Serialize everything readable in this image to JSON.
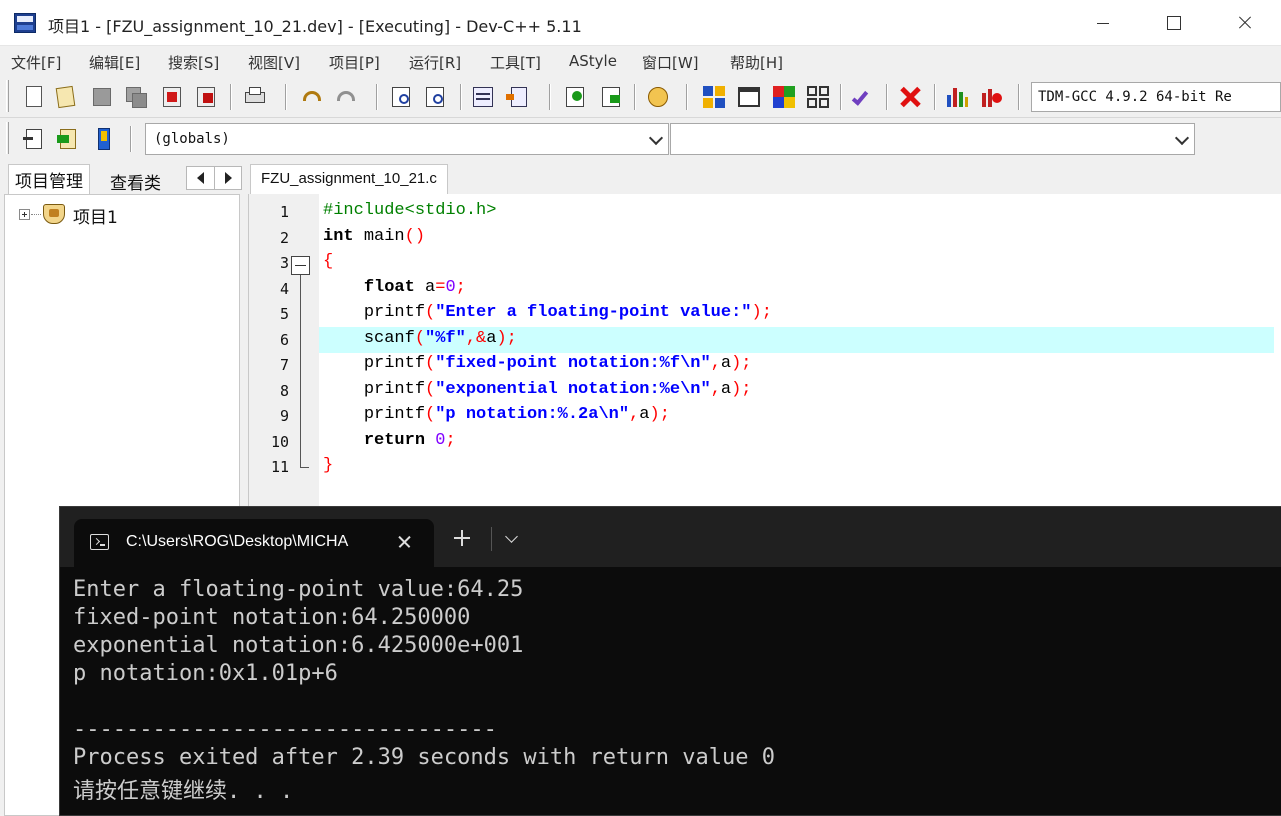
{
  "window": {
    "title": "项目1 - [FZU_assignment_10_21.dev] - [Executing] - Dev-C++ 5.11"
  },
  "menu": [
    "文件[F]",
    "编辑[E]",
    "搜索[S]",
    "视图[V]",
    "项目[P]",
    "运行[R]",
    "工具[T]",
    "AStyle",
    "窗口[W]",
    "帮助[H]"
  ],
  "toolbar": {
    "compiler": "TDM-GCC 4.9.2 64-bit Re",
    "scope_combo": "(globals)",
    "member_combo": ""
  },
  "left_panel": {
    "tab_project": "项目管理",
    "tab_classes": "查看类",
    "tree_root": "项目1"
  },
  "editor": {
    "tab": "FZU_assignment_10_21.c",
    "line_numbers": [
      "1",
      "2",
      "3",
      "4",
      "5",
      "6",
      "7",
      "8",
      "9",
      "10",
      "11"
    ],
    "highlighted_line": 6,
    "lines": [
      "#include<stdio.h>",
      "int main()",
      "{",
      "    float a=0;",
      "    printf(\"Enter a floating-point value:\");",
      "    scanf(\"%f\",&a);",
      "    printf(\"fixed-point notation:%f\\n\",a);",
      "    printf(\"exponential notation:%e\\n\",a);",
      "    printf(\"p notation:%.2a\\n\",a);",
      "    return 0;",
      "}"
    ]
  },
  "console": {
    "tab_title": "C:\\Users\\ROG\\Desktop\\MICHA",
    "output": [
      "Enter a floating-point value:64.25",
      "fixed-point notation:64.250000",
      "exponential notation:6.425000e+001",
      "p notation:0x1.01p+6",
      "",
      "--------------------------------",
      "Process exited after 2.39 seconds with return value 0",
      "请按任意键继续. . ."
    ]
  },
  "colors": {
    "preprocessor": "#008000",
    "symbol": "#ff0000",
    "string": "#0000ff",
    "number": "#8000ff",
    "highlight_row": "#ccffff",
    "console_bg": "#0c0c0c",
    "console_text": "#cccccc"
  }
}
